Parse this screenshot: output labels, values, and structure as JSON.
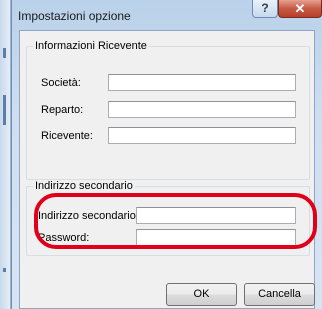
{
  "window": {
    "title": "Impostazioni opzione",
    "help_glyph": "?",
    "close_glyph": "✕"
  },
  "group_recipient": {
    "label": "Informazioni Ricevente",
    "fields": [
      {
        "label": "Società:",
        "value": ""
      },
      {
        "label": "Reparto:",
        "value": ""
      },
      {
        "label": "Ricevente:",
        "value": ""
      }
    ]
  },
  "group_secondary": {
    "label": "Indirizzo secondario",
    "fields": [
      {
        "label": "Indirizzo secondario:",
        "value": ""
      },
      {
        "label": "Password:",
        "value": ""
      }
    ]
  },
  "buttons": {
    "ok": "OK",
    "cancel": "Cancella"
  },
  "colors": {
    "highlight": "#e0001a",
    "close_button": "#c75a44"
  },
  "icons": {
    "help": "question-mark-icon",
    "close": "close-icon"
  }
}
